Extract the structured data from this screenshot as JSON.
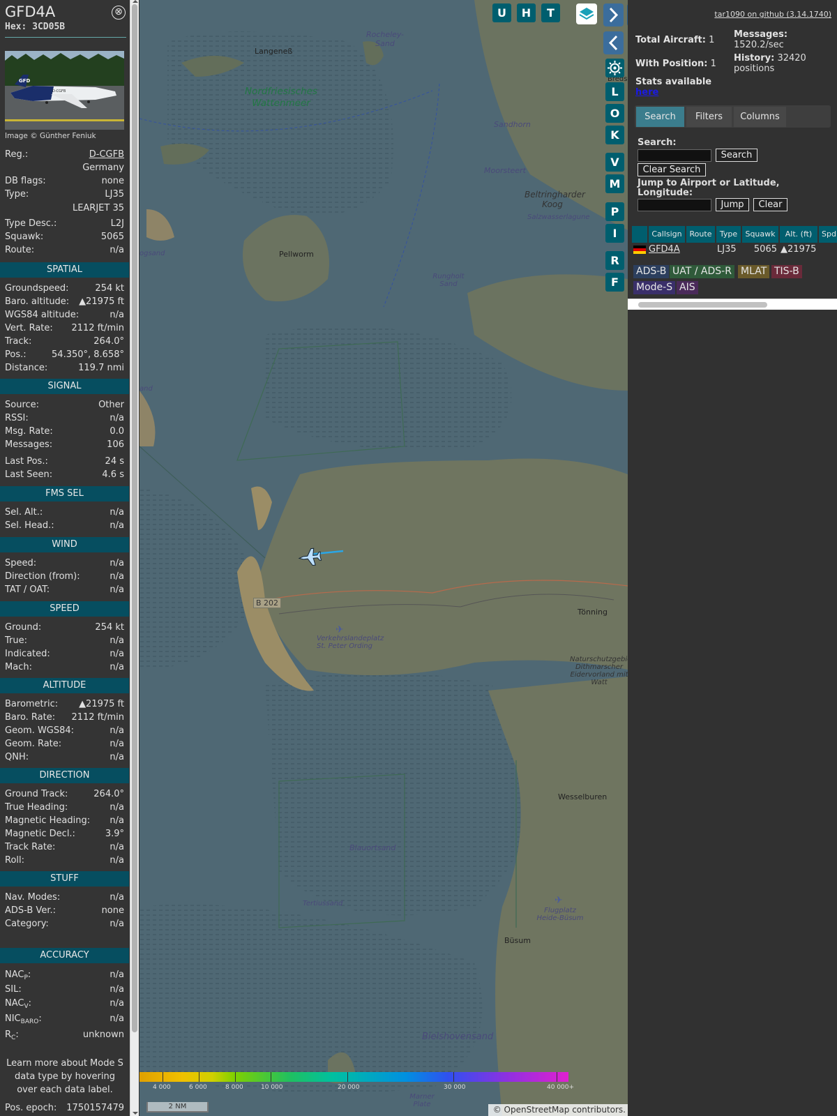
{
  "selected": {
    "callsign": "GFD4A",
    "hex": "Hex: 3CD05B",
    "close": "⊗",
    "photo_tail": "D-CGFB",
    "photo_logo": "GFD",
    "image_credit": "Image © Günther Feniuk",
    "reg_label": "Reg.:",
    "reg_value": "D-CGFB",
    "country": "Germany",
    "dbflags_label": "DB flags:",
    "dbflags_value": "none",
    "type_label": "Type:",
    "type_value": "LJ35",
    "type_name": "LEARJET 35",
    "typedesc_label": "Type Desc.:",
    "typedesc_value": "L2J",
    "squawk_label": "Squawk:",
    "squawk_value": "5065",
    "route_label": "Route:",
    "route_value": "n/a",
    "spatial": {
      "title": "SPATIAL",
      "rows": [
        {
          "k": "Groundspeed:",
          "v": "254 kt"
        },
        {
          "k": "Baro. altitude:",
          "v": "▲21975 ft"
        },
        {
          "k": "WGS84 altitude:",
          "v": "n/a"
        },
        {
          "k": "Vert. Rate:",
          "v": "2112 ft/min"
        },
        {
          "k": "Track:",
          "v": "264.0°"
        },
        {
          "k": "Pos.:",
          "v": "54.350°, 8.658°"
        },
        {
          "k": "Distance:",
          "v": "119.7 nmi"
        }
      ]
    },
    "signal": {
      "title": "SIGNAL",
      "rows": [
        {
          "k": "Source:",
          "v": "Other"
        },
        {
          "k": "RSSI:",
          "v": "n/a"
        },
        {
          "k": "Msg. Rate:",
          "v": "0.0"
        },
        {
          "k": "Messages:",
          "v": "106"
        },
        {
          "k": "Last Pos.:",
          "v": "24 s"
        },
        {
          "k": "Last Seen:",
          "v": "4.6 s"
        }
      ]
    },
    "fms": {
      "title": "FMS SEL",
      "rows": [
        {
          "k": "Sel. Alt.:",
          "v": "n/a"
        },
        {
          "k": "Sel. Head.:",
          "v": "n/a"
        }
      ]
    },
    "wind": {
      "title": "WIND",
      "rows": [
        {
          "k": "Speed:",
          "v": "n/a"
        },
        {
          "k": "Direction (from):",
          "v": "n/a"
        },
        {
          "k": "TAT / OAT:",
          "v": "n/a"
        }
      ]
    },
    "speed": {
      "title": "SPEED",
      "rows": [
        {
          "k": "Ground:",
          "v": "254 kt"
        },
        {
          "k": "True:",
          "v": "n/a"
        },
        {
          "k": "Indicated:",
          "v": "n/a"
        },
        {
          "k": "Mach:",
          "v": "n/a"
        }
      ]
    },
    "altitude": {
      "title": "ALTITUDE",
      "rows": [
        {
          "k": "Barometric:",
          "v": "▲21975 ft"
        },
        {
          "k": "Baro. Rate:",
          "v": "2112 ft/min"
        },
        {
          "k": "Geom. WGS84:",
          "v": "n/a"
        },
        {
          "k": "Geom. Rate:",
          "v": "n/a"
        },
        {
          "k": "QNH:",
          "v": "n/a"
        }
      ]
    },
    "direction": {
      "title": "DIRECTION",
      "rows": [
        {
          "k": "Ground Track:",
          "v": "264.0°"
        },
        {
          "k": "True Heading:",
          "v": "n/a"
        },
        {
          "k": "Magnetic Heading:",
          "v": "n/a"
        },
        {
          "k": "Magnetic Decl.:",
          "v": "3.9°"
        },
        {
          "k": "Track Rate:",
          "v": "n/a"
        },
        {
          "k": "Roll:",
          "v": "n/a"
        }
      ]
    },
    "stuff": {
      "title": "STUFF",
      "rows": [
        {
          "k": "Nav. Modes:",
          "v": "n/a"
        },
        {
          "k": "ADS-B Ver.:",
          "v": "none"
        },
        {
          "k": "Category:",
          "v": "n/a"
        }
      ]
    },
    "accuracy": {
      "title": "ACCURACY",
      "nacp_k": "NAC",
      "nacp_sub": "P",
      "nacp_v": "n/a",
      "sil_k": "SIL:",
      "sil_v": "n/a",
      "nacv_k": "NAC",
      "nacv_sub": "V",
      "nacv_v": "n/a",
      "nic_k": "NIC",
      "nic_sub": "BARO",
      "nic_v": "n/a",
      "rc_k": "R",
      "rc_sub": "C",
      "rc_v": "unknown"
    },
    "info_note": "Learn more about Mode S data type by hovering over each data label.",
    "epoch_k": "Pos. epoch:",
    "epoch_v": "1750157479"
  },
  "map": {
    "buttons": {
      "u": "U",
      "h": "H",
      "t": "T",
      "l": "L",
      "o": "O",
      "k": "K",
      "v": "V",
      "m": "M",
      "p": "P",
      "i": "I",
      "r": "R",
      "f": "F"
    },
    "places": [
      "Langeneß",
      "Rocheley-Sand",
      "Nordfriesisches Wattenmeer",
      "Sandhorn",
      "Moorsteert",
      "Beltringharder Koog",
      "Salzwasserlagune",
      "Pellworm",
      "Rungholt Sand",
      "B 202",
      "Tönning",
      "Verkehrslandeplatz St. Peter Ording",
      "Naturschutzgebiet Dithmarscher Eidervorland mit Watt",
      "Wesselburen",
      "Blauortsand",
      "Tertiussand",
      "Flugplatz Heide-Büsum",
      "Büsum",
      "Bielshovensand",
      "Marner Plate",
      "ogsand",
      "and",
      "Breds"
    ],
    "altitude_scale": [
      "4 000",
      "6 000",
      "8 000",
      "10 000",
      "20 000",
      "30 000",
      "40 000+"
    ],
    "scale_label": "2 NM",
    "attribution_prefix": "© ",
    "attribution_link": "OpenStreetMap",
    "attribution_suffix": " contributors."
  },
  "panel": {
    "github": "tar1090 on github (3.14.1740)",
    "total_label": "Total Aircraft:",
    "total_value": "1",
    "pos_label": "With Position:",
    "pos_value": "1",
    "msg_label": "Messages:",
    "msg_value": "1520.2/sec",
    "hist_label": "History:",
    "hist_value": "32420 positions",
    "stats_label": "Stats available",
    "stats_link": "here",
    "tabs": [
      "Search",
      "Filters",
      "Columns"
    ],
    "search_label": "Search:",
    "search_value": "",
    "search_btn": "Search",
    "clear_search_btn": "Clear Search",
    "jump_label": "Jump to Airport or Latitude, Longitude:",
    "jump_value": "",
    "jump_btn": "Jump",
    "clear_btn": "Clear",
    "columns": [
      "Callsign",
      "Route",
      "Type",
      "Squawk",
      "Alt. (ft)",
      "Spd"
    ],
    "row": {
      "callsign": "GFD4A",
      "route": "",
      "type": "LJ35",
      "squawk": "5065",
      "alt": "▲21975"
    },
    "sources": [
      "ADS-B",
      "UAT / ADS-R",
      "MLAT",
      "TIS-B",
      "Mode-S",
      "AIS"
    ]
  }
}
